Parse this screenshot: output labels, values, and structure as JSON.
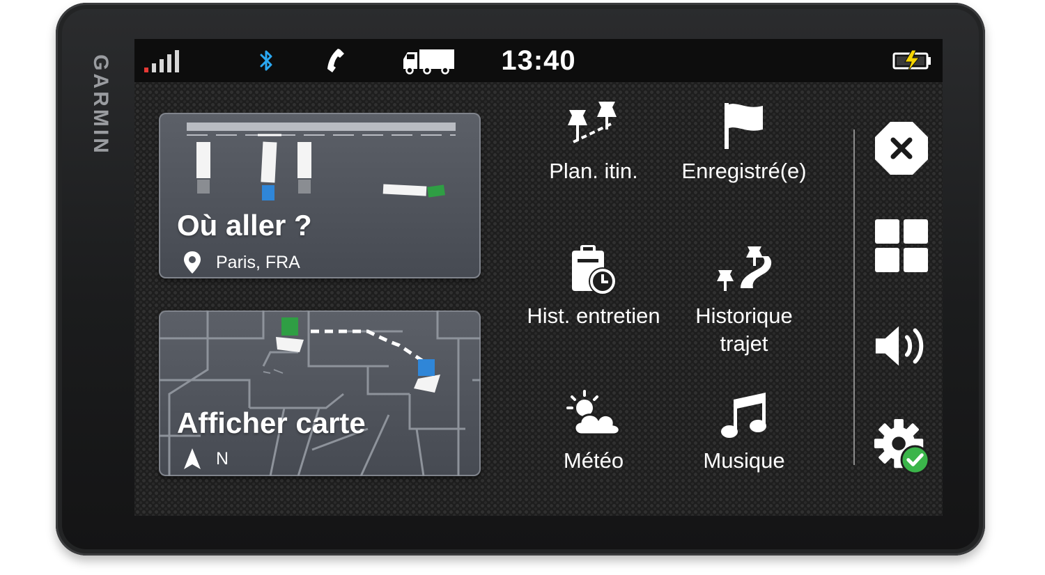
{
  "brand": "GARMIN",
  "status_bar": {
    "time": "13:40",
    "icons": [
      "signal-strength-icon",
      "bluetooth-icon",
      "phone-icon",
      "truck-icon",
      "battery-charging-icon"
    ],
    "accent_bluetooth": "#2aa8f2",
    "battery_bolt_color": "#f5d400"
  },
  "where_to_card": {
    "title": "Où aller ?",
    "location": "Paris, FRA",
    "icons": [
      "location-pin-icon"
    ]
  },
  "map_card": {
    "title": "Afficher carte",
    "heading": "N",
    "icons": [
      "north-arrow-icon"
    ]
  },
  "apps": [
    {
      "label": "Plan. itin.",
      "icon": "trip-planner-icon"
    },
    {
      "label": "Enregistré(e)",
      "icon": "saved-flag-icon"
    },
    {
      "label": "Hist. entretien",
      "icon": "service-history-icon"
    },
    {
      "label": "Historique trajet",
      "icon": "trip-history-icon"
    },
    {
      "label": "Météo",
      "icon": "weather-icon"
    },
    {
      "label": "Musique",
      "icon": "music-note-icon"
    }
  ],
  "side_buttons": [
    {
      "name": "close",
      "icon": "close-icon"
    },
    {
      "name": "apps",
      "icon": "app-grid-icon"
    },
    {
      "name": "volume",
      "icon": "volume-icon"
    },
    {
      "name": "settings",
      "icon": "settings-check-icon",
      "badge_color": "#3bb54a"
    }
  ],
  "colors": {
    "screen_bg": "#1e1e1e",
    "status_bg": "#0d0d0d",
    "card_bg": "#50545c",
    "green_marker": "#2f9e44",
    "blue_marker": "#2f86d8"
  }
}
